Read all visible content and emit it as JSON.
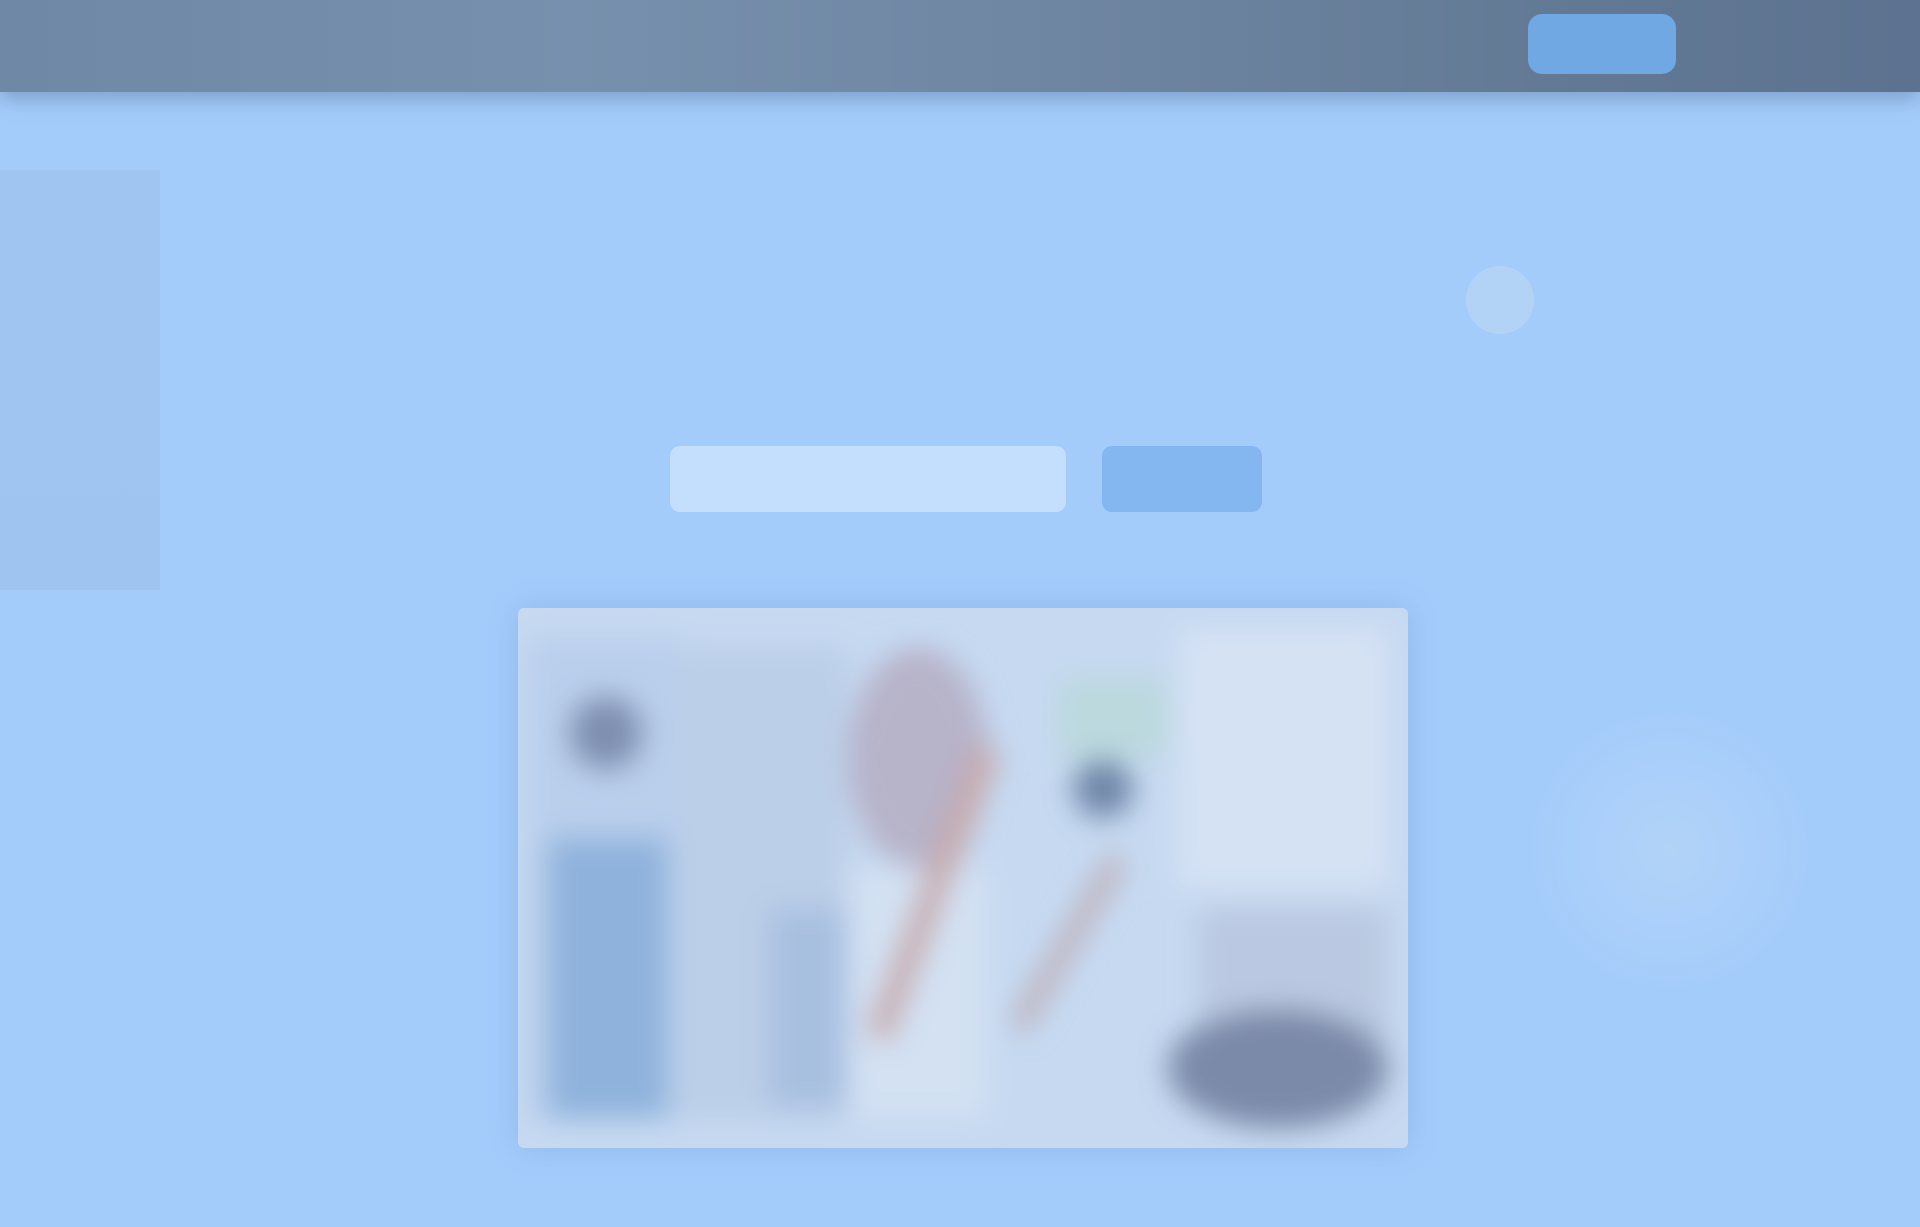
{
  "topbar": {
    "cta_label": ""
  },
  "hero": {
    "title": "",
    "subtitle_prefix": "",
    "subtitle_highlight": "",
    "icon": "decorative-circle-icon"
  },
  "signup": {
    "email_value": "",
    "email_placeholder": "",
    "submit_label": ""
  },
  "colors": {
    "page_background": "#a4ccfb",
    "topbar_background": "#6e88a6",
    "accent": "#6aaaf5",
    "button": "#84b6ef",
    "input": "#c4dffd"
  }
}
